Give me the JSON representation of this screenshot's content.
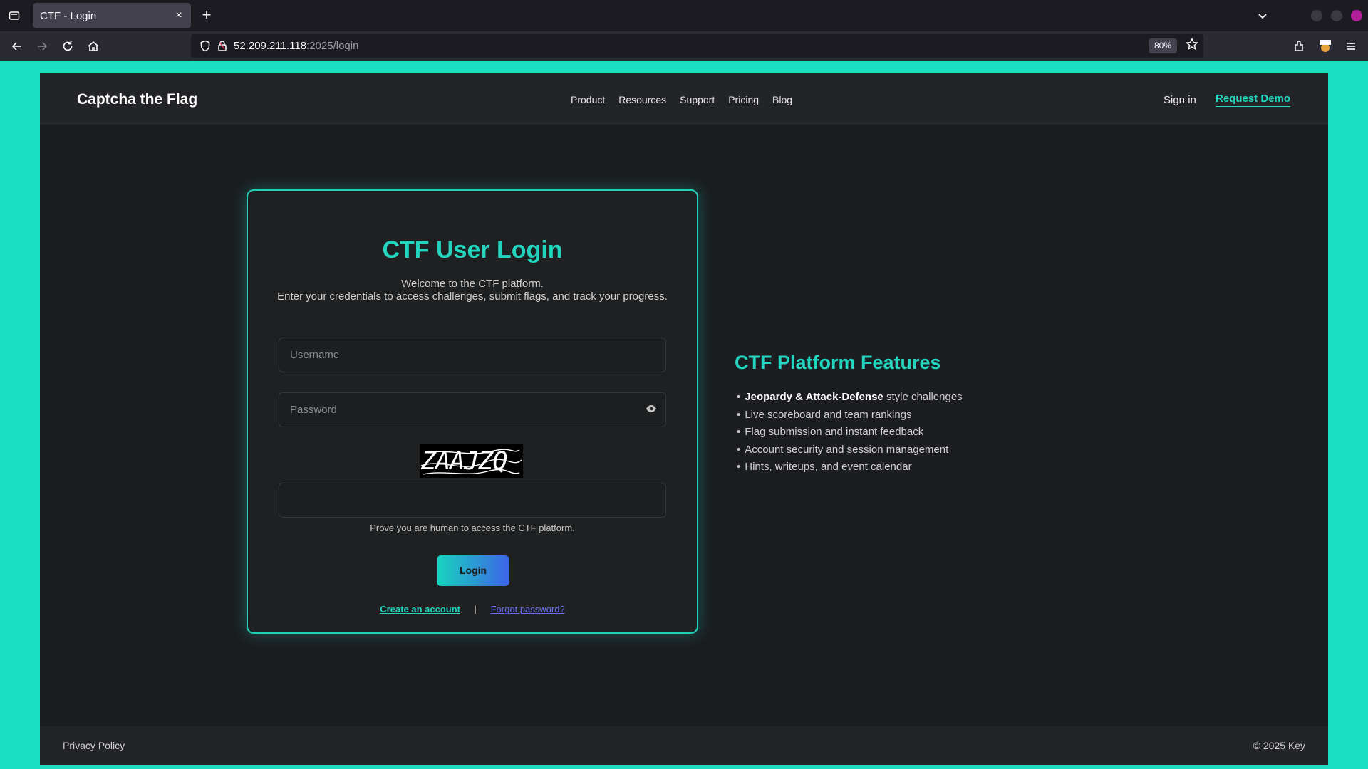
{
  "browser": {
    "tab_title": "CTF - Login",
    "url_host": "52.209.211.118",
    "url_path": ":2025/login",
    "zoom": "80%"
  },
  "header": {
    "brand": "Captcha the Flag",
    "menu": [
      "Product",
      "Resources",
      "Support",
      "Pricing",
      "Blog"
    ],
    "sign_in": "Sign in",
    "request_demo": "Request Demo"
  },
  "login": {
    "title": "CTF User Login",
    "subtitle_line1": "Welcome to the CTF platform.",
    "subtitle_line2": "Enter your credentials to access challenges, submit flags, and track your progress.",
    "username_placeholder": "Username",
    "password_placeholder": "Password",
    "captcha_text": "ZAAJZQ",
    "captcha_value": "",
    "captcha_hint": "Prove you are human to access the CTF platform.",
    "login_button": "Login",
    "create_account": "Create an account",
    "separator": "|",
    "forgot_password": "Forgot password?"
  },
  "features": {
    "title": "CTF Platform Features",
    "item1_bold": "Jeopardy & Attack-Defense",
    "item1_rest": " style challenges",
    "item2": "Live scoreboard and team rankings",
    "item3": "Flag submission and instant feedback",
    "item4": "Account security and session management",
    "item5": "Hints, writeups, and event calendar"
  },
  "footer": {
    "privacy": "Privacy Policy",
    "copyright": "© 2025 Key"
  },
  "icons": {
    "back": "arrow-left-icon",
    "forward": "arrow-right-icon",
    "reload": "reload-icon",
    "home": "home-icon",
    "shield": "shield-icon",
    "lock": "lock-icon",
    "star": "star-icon",
    "eye": "eye-icon"
  },
  "colors": {
    "accent": "#23d5bf",
    "link_secondary": "#6a6ff2",
    "background": "#1b1d20"
  }
}
